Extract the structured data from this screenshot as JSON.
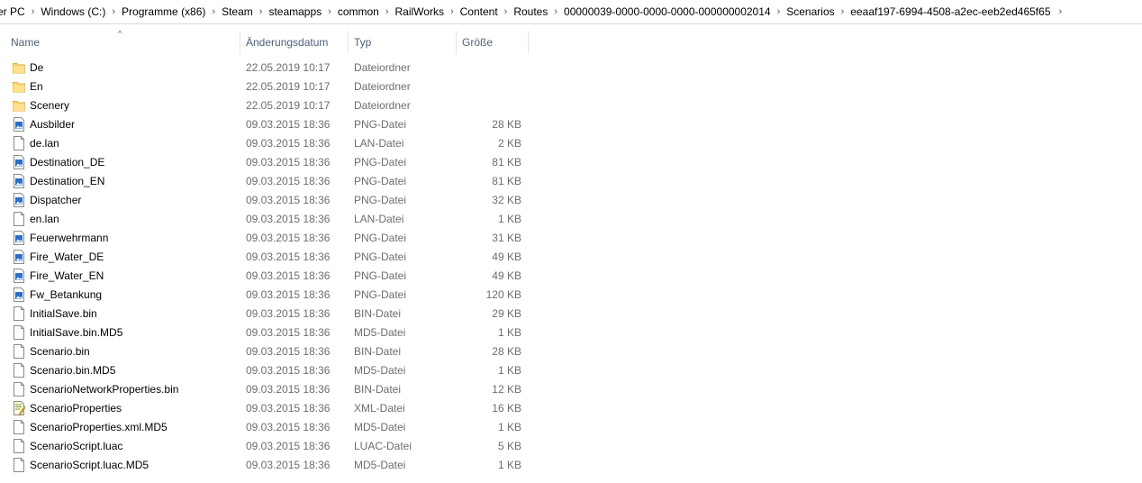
{
  "breadcrumb": [
    "ser PC",
    "Windows (C:)",
    "Programme (x86)",
    "Steam",
    "steamapps",
    "common",
    "RailWorks",
    "Content",
    "Routes",
    "00000039-0000-0000-0000-000000002014",
    "Scenarios",
    "eeaaf197-6994-4508-a2ec-eeb2ed465f65"
  ],
  "columns": {
    "name": "Name",
    "date": "Änderungsdatum",
    "type": "Typ",
    "size": "Größe"
  },
  "files": [
    {
      "name": "De",
      "date": "22.05.2019 10:17",
      "type": "Dateiordner",
      "size": "",
      "icon": "folder-icon"
    },
    {
      "name": "En",
      "date": "22.05.2019 10:17",
      "type": "Dateiordner",
      "size": "",
      "icon": "folder-icon"
    },
    {
      "name": "Scenery",
      "date": "22.05.2019 10:17",
      "type": "Dateiordner",
      "size": "",
      "icon": "folder-icon"
    },
    {
      "name": "Ausbilder",
      "date": "09.03.2015 18:36",
      "type": "PNG-Datei",
      "size": "28 KB",
      "icon": "image-file-icon"
    },
    {
      "name": "de.lan",
      "date": "09.03.2015 18:36",
      "type": "LAN-Datei",
      "size": "2 KB",
      "icon": "file-icon"
    },
    {
      "name": "Destination_DE",
      "date": "09.03.2015 18:36",
      "type": "PNG-Datei",
      "size": "81 KB",
      "icon": "image-file-icon"
    },
    {
      "name": "Destination_EN",
      "date": "09.03.2015 18:36",
      "type": "PNG-Datei",
      "size": "81 KB",
      "icon": "image-file-icon"
    },
    {
      "name": "Dispatcher",
      "date": "09.03.2015 18:36",
      "type": "PNG-Datei",
      "size": "32 KB",
      "icon": "image-file-icon"
    },
    {
      "name": "en.lan",
      "date": "09.03.2015 18:36",
      "type": "LAN-Datei",
      "size": "1 KB",
      "icon": "file-icon"
    },
    {
      "name": "Feuerwehrmann",
      "date": "09.03.2015 18:36",
      "type": "PNG-Datei",
      "size": "31 KB",
      "icon": "image-file-icon"
    },
    {
      "name": "Fire_Water_DE",
      "date": "09.03.2015 18:36",
      "type": "PNG-Datei",
      "size": "49 KB",
      "icon": "image-file-icon"
    },
    {
      "name": "Fire_Water_EN",
      "date": "09.03.2015 18:36",
      "type": "PNG-Datei",
      "size": "49 KB",
      "icon": "image-file-icon"
    },
    {
      "name": "Fw_Betankung",
      "date": "09.03.2015 18:36",
      "type": "PNG-Datei",
      "size": "120 KB",
      "icon": "image-file-icon"
    },
    {
      "name": "InitialSave.bin",
      "date": "09.03.2015 18:36",
      "type": "BIN-Datei",
      "size": "29 KB",
      "icon": "file-icon"
    },
    {
      "name": "InitialSave.bin.MD5",
      "date": "09.03.2015 18:36",
      "type": "MD5-Datei",
      "size": "1 KB",
      "icon": "file-icon"
    },
    {
      "name": "Scenario.bin",
      "date": "09.03.2015 18:36",
      "type": "BIN-Datei",
      "size": "28 KB",
      "icon": "file-icon"
    },
    {
      "name": "Scenario.bin.MD5",
      "date": "09.03.2015 18:36",
      "type": "MD5-Datei",
      "size": "1 KB",
      "icon": "file-icon"
    },
    {
      "name": "ScenarioNetworkProperties.bin",
      "date": "09.03.2015 18:36",
      "type": "BIN-Datei",
      "size": "12 KB",
      "icon": "file-icon"
    },
    {
      "name": "ScenarioProperties",
      "date": "09.03.2015 18:36",
      "type": "XML-Datei",
      "size": "16 KB",
      "icon": "xml-file-icon"
    },
    {
      "name": "ScenarioProperties.xml.MD5",
      "date": "09.03.2015 18:36",
      "type": "MD5-Datei",
      "size": "1 KB",
      "icon": "file-icon"
    },
    {
      "name": "ScenarioScript.luac",
      "date": "09.03.2015 18:36",
      "type": "LUAC-Datei",
      "size": "5 KB",
      "icon": "file-icon"
    },
    {
      "name": "ScenarioScript.luac.MD5",
      "date": "09.03.2015 18:36",
      "type": "MD5-Datei",
      "size": "1 KB",
      "icon": "file-icon"
    }
  ]
}
